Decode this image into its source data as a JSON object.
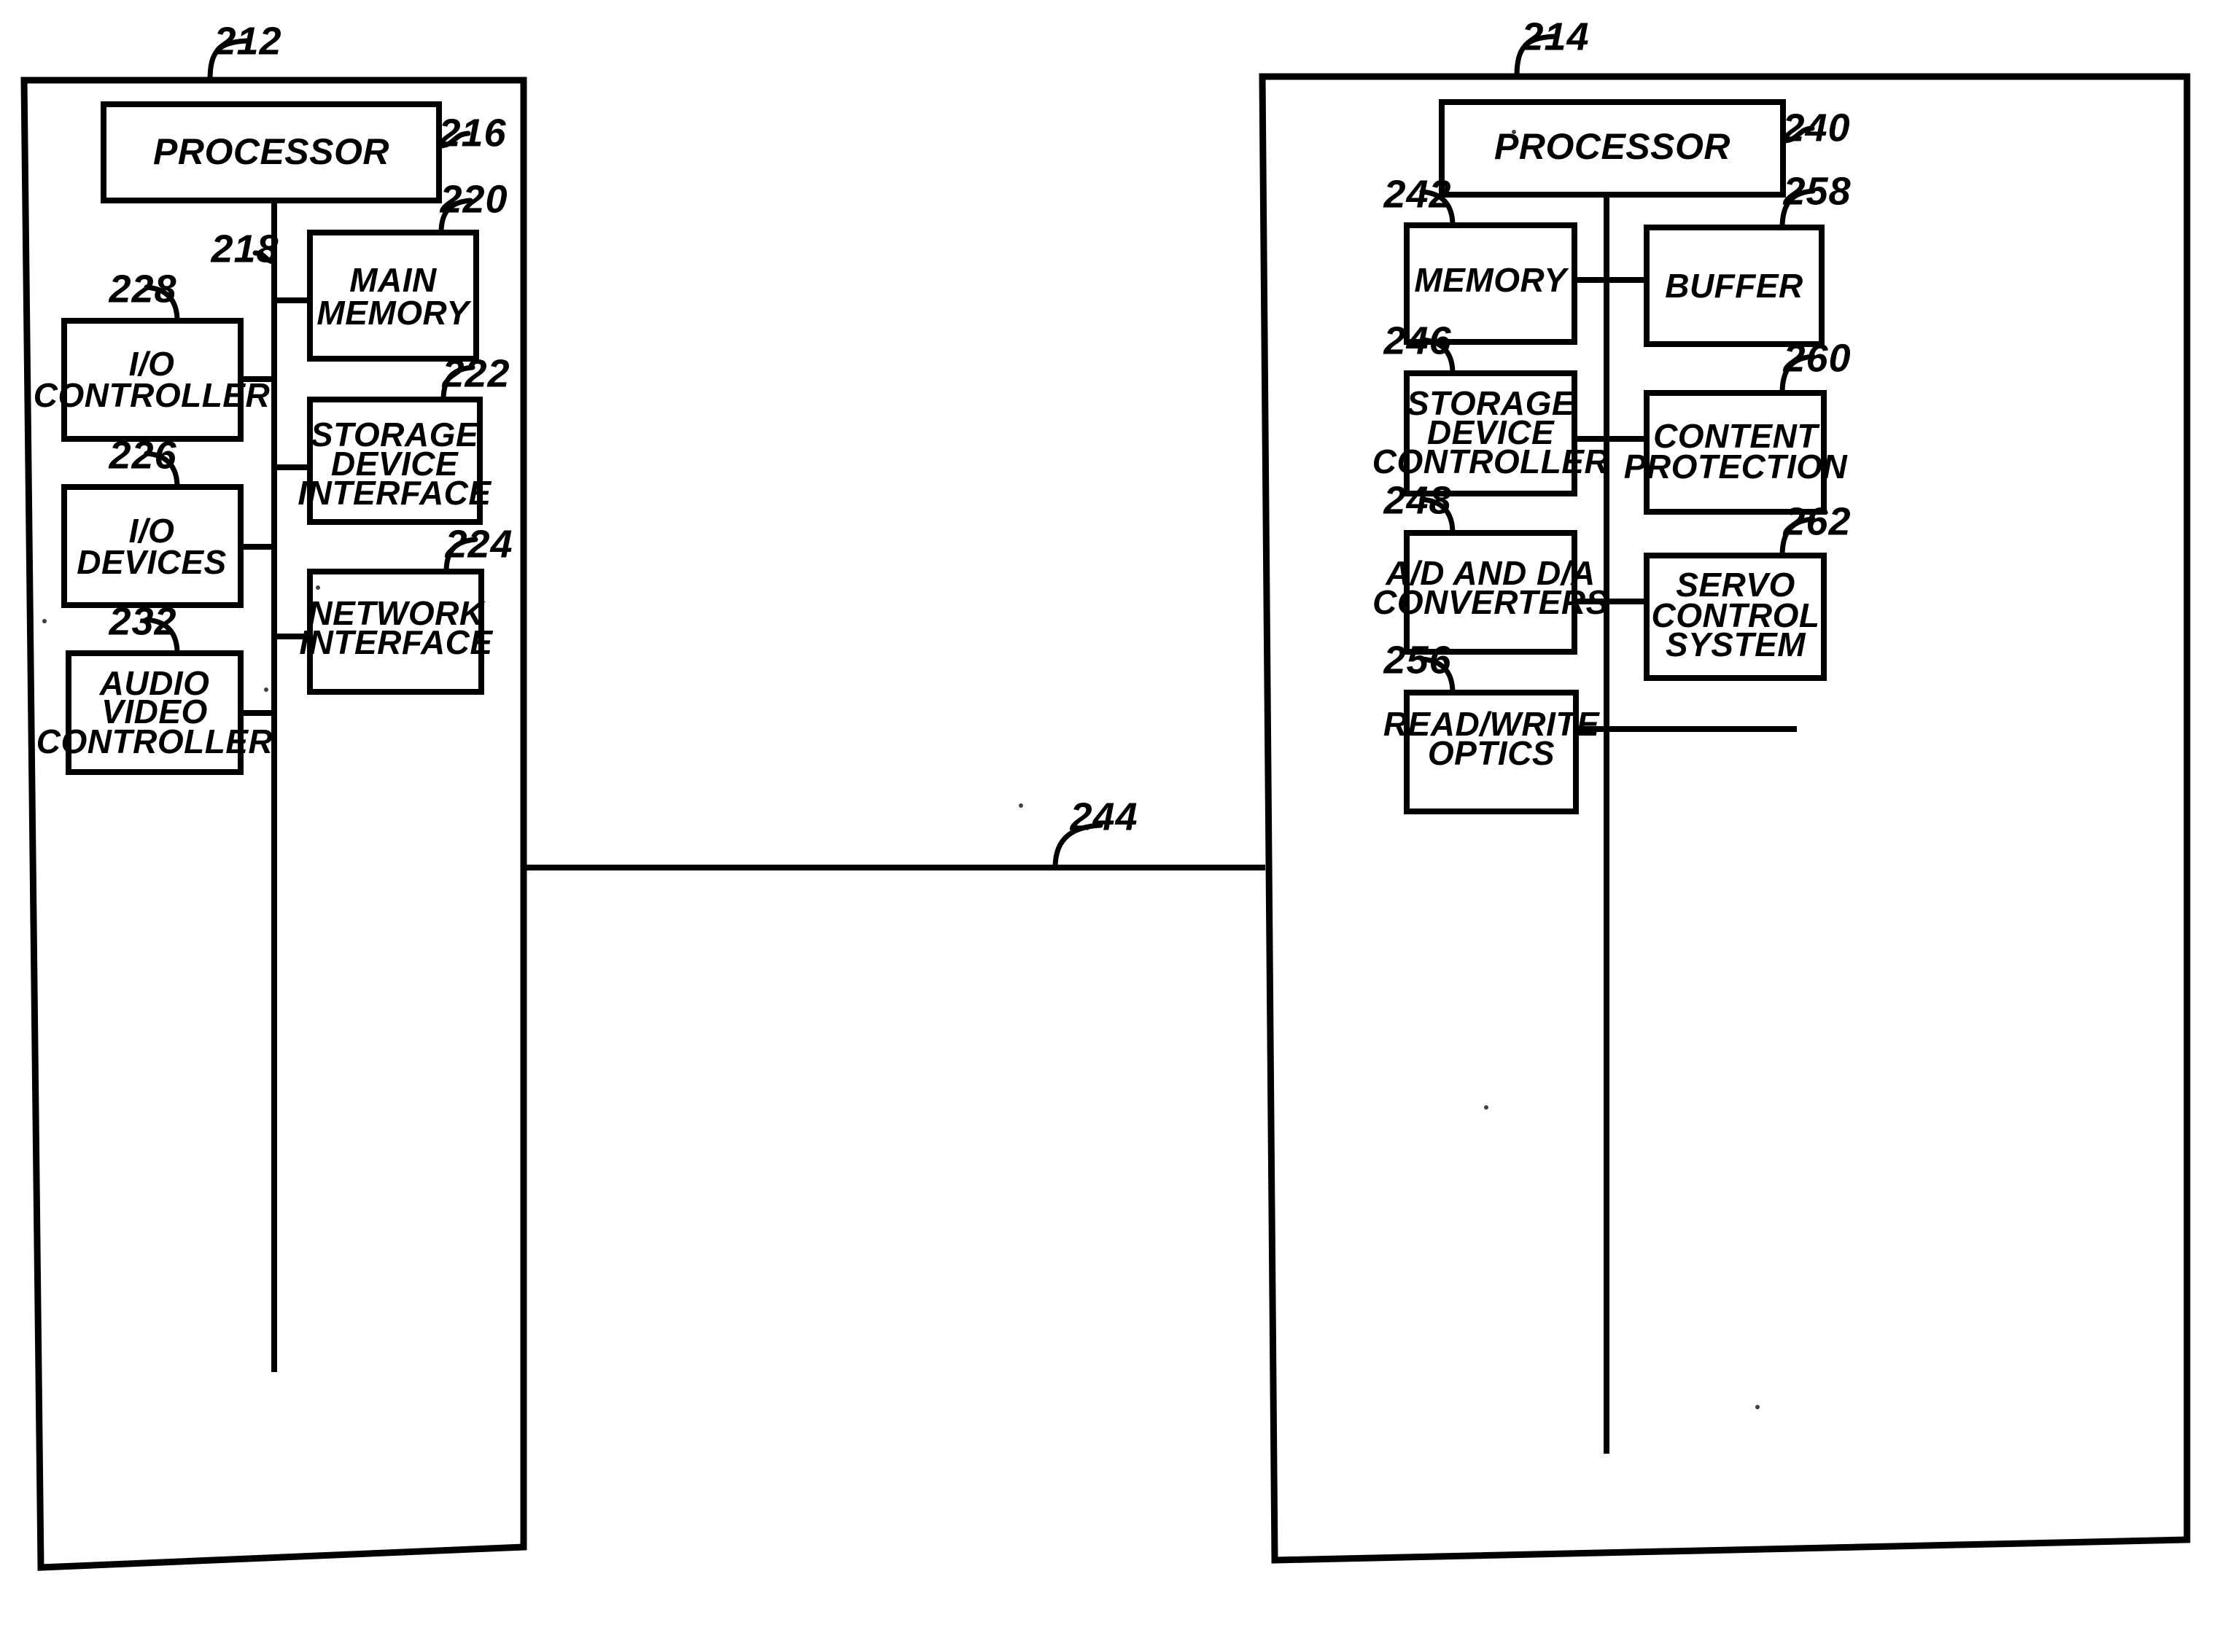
{
  "figure": {
    "type": "patent-block-diagram",
    "description": "Block diagram of a host computer system connected to an optical disc drive device"
  },
  "panels": [
    {
      "id": "host-system",
      "ref": "212",
      "blocks": [
        {
          "id": "processor",
          "ref": "216",
          "lines": [
            "PROCESSOR"
          ]
        },
        {
          "id": "main-memory",
          "ref": "220",
          "lines": [
            "MAIN",
            "MEMORY"
          ]
        },
        {
          "id": "storage-device-interface",
          "ref": "222",
          "lines": [
            "STORAGE",
            "DEVICE",
            "INTERFACE"
          ]
        },
        {
          "id": "network-interface",
          "ref": "224",
          "lines": [
            "NETWORK",
            "INTERFACE"
          ]
        },
        {
          "id": "io-controller",
          "ref": "228",
          "lines": [
            "I/O",
            "CONTROLLER"
          ]
        },
        {
          "id": "io-devices",
          "ref": "226",
          "lines": [
            "I/O",
            "DEVICES"
          ]
        },
        {
          "id": "audio-video-controller",
          "ref": "232",
          "lines": [
            "AUDIO",
            "VIDEO",
            "CONTROLLER"
          ]
        }
      ],
      "bus": {
        "ref": "218"
      }
    },
    {
      "id": "drive-device",
      "ref": "214",
      "blocks": [
        {
          "id": "processor-2",
          "ref": "240",
          "lines": [
            "PROCESSOR"
          ]
        },
        {
          "id": "memory",
          "ref": "242",
          "lines": [
            "MEMORY"
          ]
        },
        {
          "id": "buffer",
          "ref": "258",
          "lines": [
            "BUFFER"
          ]
        },
        {
          "id": "storage-device-controller",
          "ref": "246",
          "lines": [
            "STORAGE",
            "DEVICE",
            "CONTROLLER"
          ]
        },
        {
          "id": "content-protection",
          "ref": "260",
          "lines": [
            "CONTENT",
            "PROTECTION"
          ]
        },
        {
          "id": "ad-da-converters",
          "ref": "248",
          "lines": [
            "A/D AND D/A",
            "CONVERTERS"
          ]
        },
        {
          "id": "servo-control-system",
          "ref": "262",
          "lines": [
            "SERVO",
            "CONTROL",
            "SYSTEM"
          ]
        },
        {
          "id": "read-write-optics",
          "ref": "256",
          "lines": [
            "READ/WRITE",
            "OPTICS"
          ]
        }
      ]
    }
  ],
  "interconnect": {
    "id": "host-drive-link",
    "ref": "244"
  },
  "reference_numerals": [
    "212",
    "214",
    "216",
    "218",
    "220",
    "222",
    "224",
    "226",
    "228",
    "232",
    "240",
    "242",
    "244",
    "246",
    "248",
    "256",
    "258",
    "260",
    "262"
  ],
  "colors": {
    "ink": "#000000",
    "paper": "#ffffff"
  }
}
